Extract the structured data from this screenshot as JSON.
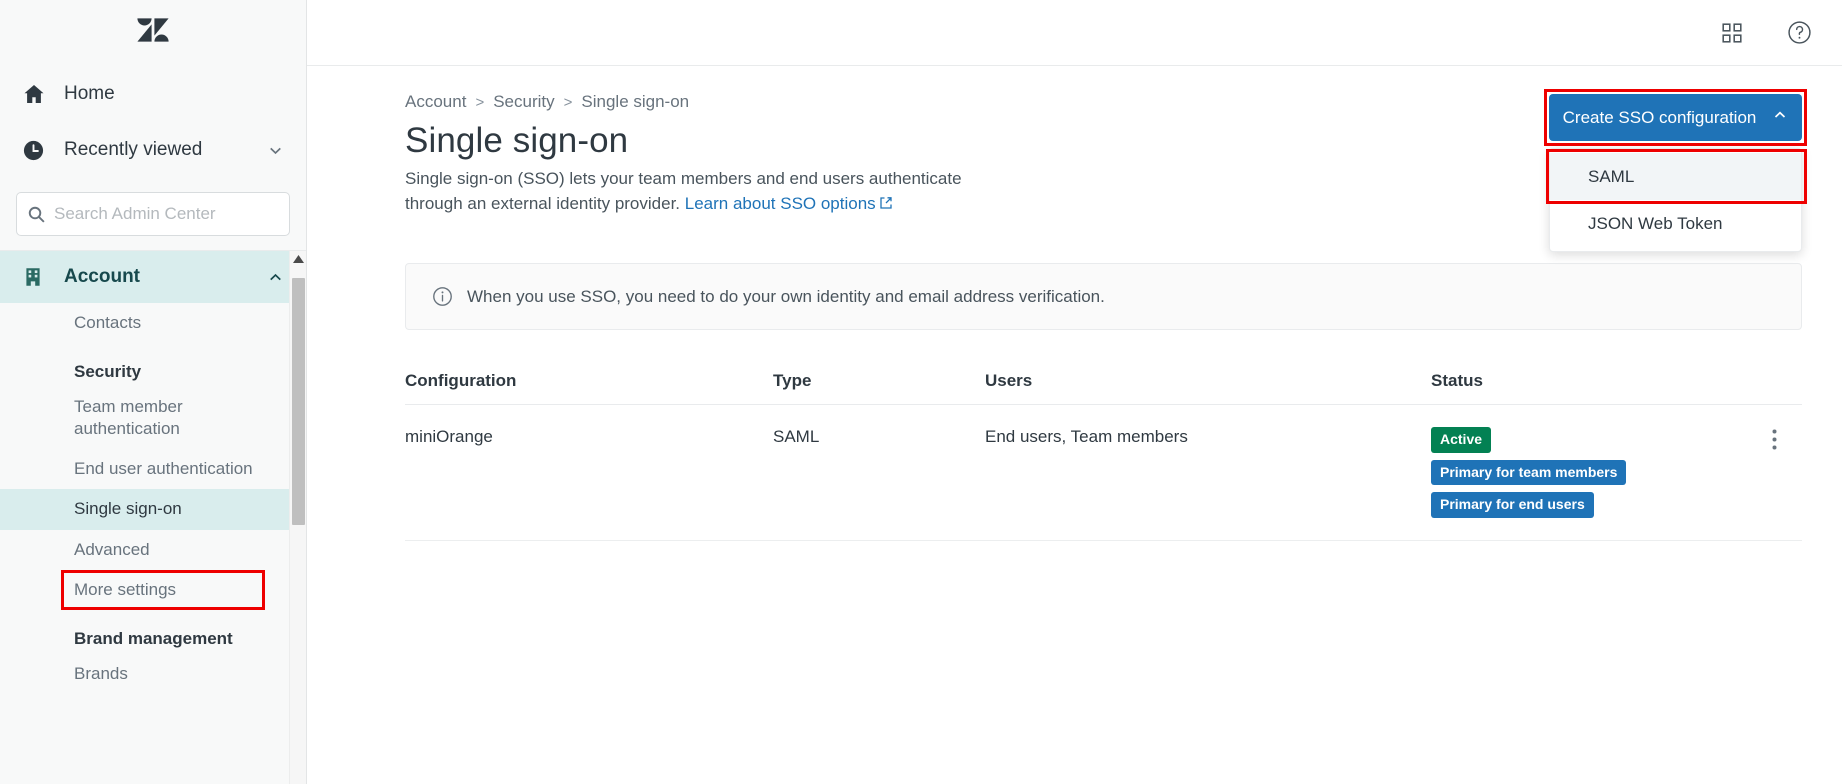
{
  "sidebar": {
    "logo_icon": "zendesk-logo",
    "nav": [
      {
        "label": "Home",
        "icon": "home-icon"
      },
      {
        "label": "Recently viewed",
        "icon": "clock-icon",
        "chevron": "chevron-down-icon"
      }
    ],
    "search": {
      "placeholder": "Search Admin Center",
      "value": "",
      "icon": "search-icon"
    },
    "section": {
      "label": "Account",
      "icon": "building-icon",
      "chevron": "chevron-up-icon"
    },
    "items": [
      {
        "label": "Contacts",
        "type": "link"
      },
      {
        "label": "Security",
        "type": "group"
      },
      {
        "label": "Team member authentication",
        "type": "link"
      },
      {
        "label": "End user authentication",
        "type": "link"
      },
      {
        "label": "Single sign-on",
        "type": "link",
        "active": true,
        "highlighted": true
      },
      {
        "label": "Advanced",
        "type": "link"
      },
      {
        "label": "More settings",
        "type": "link"
      },
      {
        "label": "Brand management",
        "type": "group"
      },
      {
        "label": "Brands",
        "type": "link"
      }
    ]
  },
  "topbar": {
    "icons": [
      {
        "name": "apps-grid-icon"
      },
      {
        "name": "help-circle-icon"
      }
    ]
  },
  "breadcrumb": [
    "Account",
    "Security",
    "Single sign-on"
  ],
  "page": {
    "title": "Single sign-on",
    "description_line1": "Single sign-on (SSO) lets your team members and end users authenticate through an",
    "description_line2": "external identity provider.",
    "link_text": "Learn about SSO options",
    "link_icon": "external-link-icon"
  },
  "actions": {
    "primary_button": {
      "label": "Create SSO configuration",
      "chevron": "chevron-up-icon",
      "color": "#1f73b7"
    },
    "menu_items": [
      {
        "label": "SAML",
        "hovered": true,
        "highlighted": true
      },
      {
        "label": "JSON Web Token",
        "hovered": false,
        "highlighted": false
      }
    ]
  },
  "banner": {
    "icon": "info-circle-icon",
    "text": "When you use SSO, you need to do your own identity and email address verification."
  },
  "table": {
    "headers": [
      "Configuration",
      "Type",
      "Users",
      "Status"
    ],
    "rows": [
      {
        "configuration": "miniOrange",
        "type": "SAML",
        "users": "End users, Team members",
        "badges": [
          {
            "label": "Active",
            "color": "#038153"
          },
          {
            "label": "Primary for team members",
            "color": "#1f73b7"
          },
          {
            "label": "Primary for end users",
            "color": "#1f73b7"
          }
        ],
        "menu_icon": "kebab-menu-icon"
      }
    ]
  },
  "highlight_color": "#ee0000"
}
